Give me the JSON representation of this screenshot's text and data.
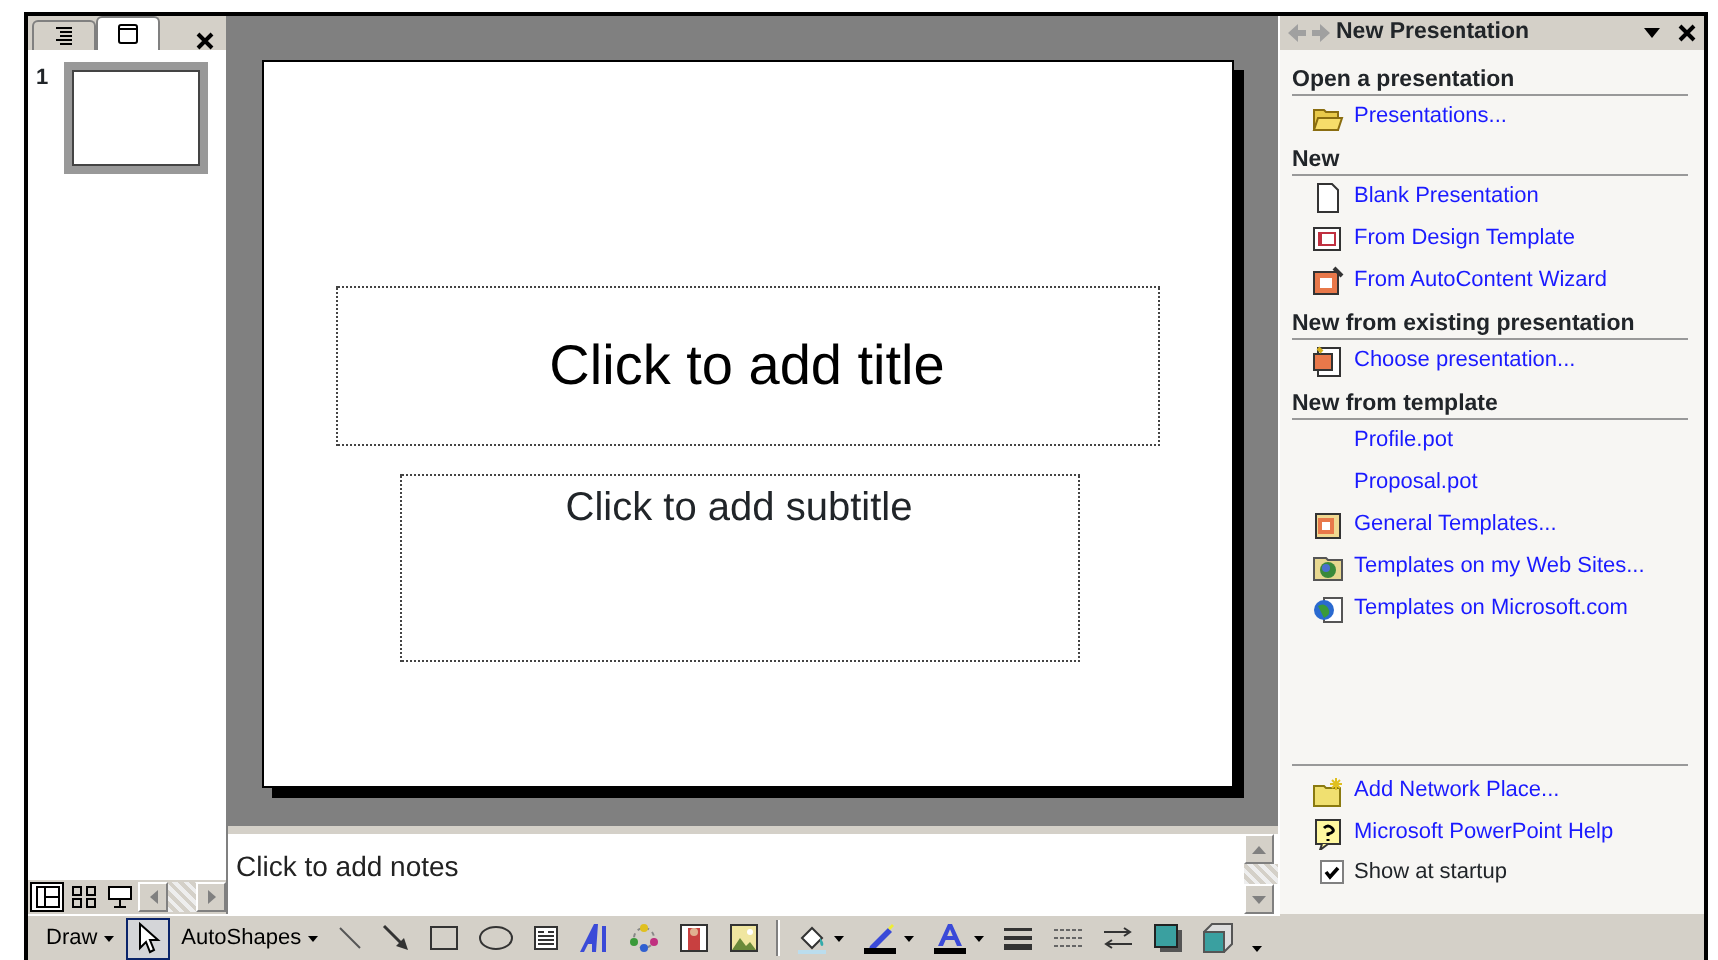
{
  "left_pane": {
    "tabs": [
      {
        "kind": "outline",
        "selected": false
      },
      {
        "kind": "slides",
        "selected": true
      }
    ],
    "slides": [
      {
        "number": "1",
        "selected": true
      }
    ],
    "view_buttons": [
      {
        "kind": "normal",
        "selected": true
      },
      {
        "kind": "sorter",
        "selected": false
      },
      {
        "kind": "show",
        "selected": false
      }
    ]
  },
  "slide": {
    "title_placeholder": "Click to add title",
    "subtitle_placeholder": "Click to add subtitle"
  },
  "notes": {
    "placeholder": "Click to add notes"
  },
  "task_pane": {
    "title": "New Presentation",
    "sections": [
      {
        "heading": "Open a presentation",
        "items": [
          {
            "kind": "folder",
            "label": "Presentations..."
          }
        ]
      },
      {
        "heading": "New",
        "items": [
          {
            "kind": "blank",
            "label": "Blank Presentation"
          },
          {
            "kind": "design",
            "label": "From Design Template"
          },
          {
            "kind": "wizard",
            "label": "From AutoContent Wizard"
          }
        ]
      },
      {
        "heading": "New from existing presentation",
        "items": [
          {
            "kind": "choose",
            "label": "Choose presentation..."
          }
        ]
      },
      {
        "heading": "New from template",
        "items": [
          {
            "kind": "none",
            "label": "Profile.pot"
          },
          {
            "kind": "none",
            "label": "Proposal.pot"
          },
          {
            "kind": "general",
            "label": "General Templates..."
          },
          {
            "kind": "web",
            "label": "Templates on my Web Sites..."
          },
          {
            "kind": "globe",
            "label": "Templates on Microsoft.com"
          }
        ]
      }
    ],
    "footer_links": [
      {
        "kind": "network",
        "label": "Add Network Place..."
      },
      {
        "kind": "help",
        "label": "Microsoft PowerPoint Help"
      }
    ],
    "show_at_startup": {
      "label": "Show at startup",
      "checked": true
    }
  },
  "draw_toolbar": [
    {
      "kind": "menu",
      "label": "Draw",
      "selected": false
    },
    {
      "kind": "select",
      "selected": true
    },
    {
      "kind": "menu",
      "label": "AutoShapes",
      "selected": false
    },
    {
      "kind": "line",
      "selected": false
    },
    {
      "kind": "arrow",
      "selected": false
    },
    {
      "kind": "rectangle",
      "selected": false
    },
    {
      "kind": "oval",
      "selected": false
    },
    {
      "kind": "textbox",
      "selected": false
    },
    {
      "kind": "wordart",
      "selected": false
    },
    {
      "kind": "diagram",
      "selected": false
    },
    {
      "kind": "clipart",
      "selected": false
    },
    {
      "kind": "picture",
      "selected": false
    },
    {
      "kind": "separator"
    },
    {
      "kind": "fill",
      "selected": false
    },
    {
      "kind": "linecolor",
      "selected": false
    },
    {
      "kind": "fontcolor",
      "selected": false
    },
    {
      "kind": "linestyle",
      "selected": false
    },
    {
      "kind": "dashstyle",
      "selected": false
    },
    {
      "kind": "arrowstyle",
      "selected": false
    },
    {
      "kind": "shadow",
      "selected": false
    },
    {
      "kind": "threed",
      "selected": false
    },
    {
      "kind": "more",
      "selected": false
    }
  ]
}
